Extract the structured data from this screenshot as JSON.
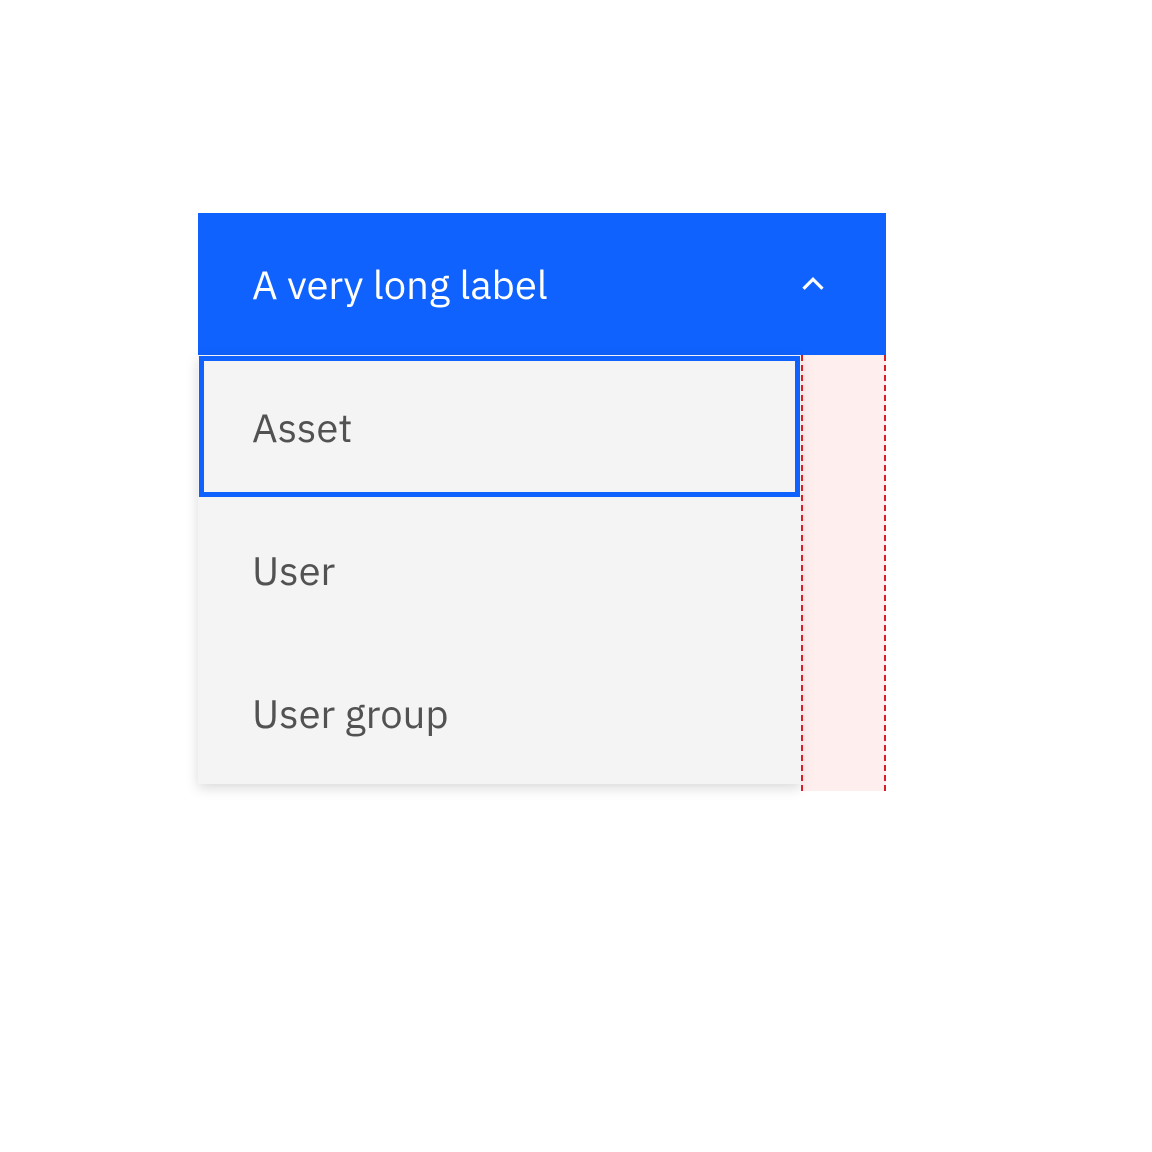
{
  "dropdown": {
    "trigger_label": "A very long label",
    "items": [
      {
        "label": "Asset"
      },
      {
        "label": "User"
      },
      {
        "label": "User group"
      }
    ]
  },
  "colors": {
    "accent": "#0f62fe",
    "error": "#da1e28",
    "overflow_bg": "rgba(255,207,207,0.35)",
    "menu_bg": "#f4f4f4",
    "text": "#525252"
  }
}
